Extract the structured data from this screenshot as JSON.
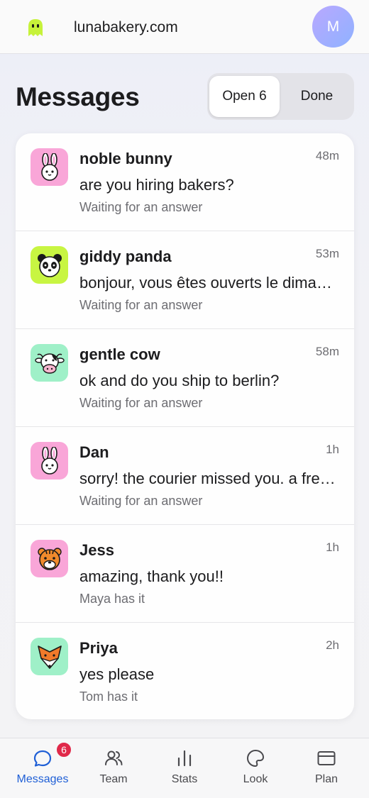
{
  "header": {
    "site": "lunabakery.com",
    "avatar_initial": "M",
    "logo_icon": "ghost-logo-icon"
  },
  "title": "Messages",
  "tabs": {
    "open_label": "Open 6",
    "done_label": "Done"
  },
  "conversations": [
    {
      "name": "noble bunny",
      "time": "48m",
      "message": "are you hiring bakers?",
      "status": "Waiting for an answer",
      "avatar_icon": "bunny-icon",
      "avatar_bg": "#f9a6d8"
    },
    {
      "name": "giddy panda",
      "time": "53m",
      "message": "bonjour, vous êtes ouverts le dima…",
      "status": "Waiting for an answer",
      "avatar_icon": "panda-icon",
      "avatar_bg": "#c8f542"
    },
    {
      "name": "gentle cow",
      "time": "58m",
      "message": "ok and do you ship to berlin?",
      "status": "Waiting for an answer",
      "avatar_icon": "cow-icon",
      "avatar_bg": "#9ff0c8"
    },
    {
      "name": "Dan",
      "time": "1h",
      "message": "sorry! the courier missed you. a fre…",
      "status": "Waiting for an answer",
      "avatar_icon": "bunny-icon",
      "avatar_bg": "#f9a6d8"
    },
    {
      "name": "Jess",
      "time": "1h",
      "message": "amazing, thank you!!",
      "status": "Maya has it",
      "avatar_icon": "tiger-icon",
      "avatar_bg": "#f9a6d8"
    },
    {
      "name": "Priya",
      "time": "2h",
      "message": "yes please",
      "status": "Tom has it",
      "avatar_icon": "fox-icon",
      "avatar_bg": "#9ff0c8"
    }
  ],
  "nav": [
    {
      "label": "Messages",
      "icon": "chat-bubble-icon",
      "badge": "6",
      "active": true
    },
    {
      "label": "Team",
      "icon": "people-icon"
    },
    {
      "label": "Stats",
      "icon": "bar-chart-icon"
    },
    {
      "label": "Look",
      "icon": "palette-icon"
    },
    {
      "label": "Plan",
      "icon": "card-icon"
    }
  ],
  "colors": {
    "accent": "#1f5fd6",
    "badge": "#e0294a"
  }
}
